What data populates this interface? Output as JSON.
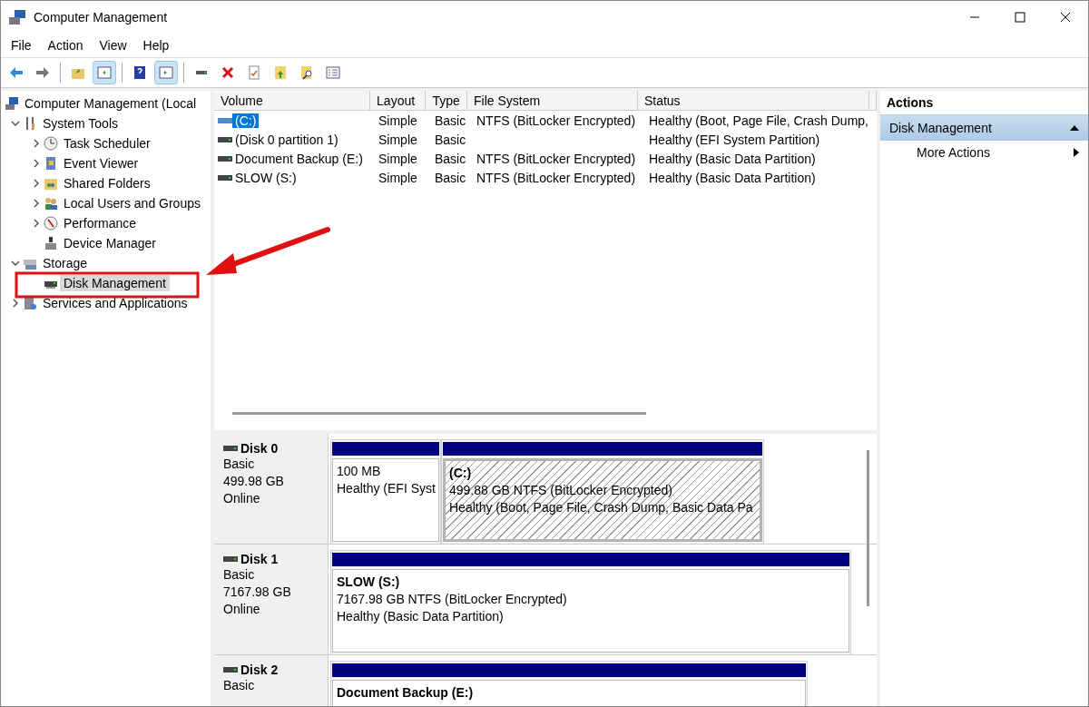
{
  "window": {
    "title": "Computer Management"
  },
  "menu": [
    {
      "label": "File"
    },
    {
      "label": "Action"
    },
    {
      "label": "View"
    },
    {
      "label": "Help"
    }
  ],
  "toolbar": [
    {
      "kind": "back",
      "pressed": false
    },
    {
      "kind": "forward",
      "pressed": false
    },
    {
      "kind": "sep"
    },
    {
      "kind": "up",
      "pressed": false
    },
    {
      "kind": "showtree",
      "pressed": true
    },
    {
      "kind": "sep"
    },
    {
      "kind": "help",
      "pressed": false
    },
    {
      "kind": "showaction",
      "pressed": true
    },
    {
      "kind": "sep"
    },
    {
      "kind": "connect",
      "pressed": false
    },
    {
      "kind": "delete",
      "pressed": false
    },
    {
      "kind": "check",
      "pressed": false
    },
    {
      "kind": "export",
      "pressed": false
    },
    {
      "kind": "find",
      "pressed": false
    },
    {
      "kind": "props",
      "pressed": false
    }
  ],
  "tree": [
    {
      "label": "Computer Management (Local",
      "selected": false,
      "children": [
        {
          "label": "System Tools",
          "expanded": true,
          "selected": false,
          "children": [
            {
              "label": "Task Scheduler",
              "expanded": false,
              "selected": false
            },
            {
              "label": "Event Viewer",
              "expanded": false,
              "selected": false
            },
            {
              "label": "Shared Folders",
              "expanded": false,
              "selected": false
            },
            {
              "label": "Local Users and Groups",
              "expanded": false,
              "selected": false
            },
            {
              "label": "Performance",
              "expanded": false,
              "selected": false
            },
            {
              "label": "Device Manager",
              "selected": false
            }
          ]
        },
        {
          "label": "Storage",
          "expanded": true,
          "selected": false,
          "children": [
            {
              "label": "Disk Management",
              "selected": true
            }
          ]
        },
        {
          "label": "Services and Applications",
          "expanded": false,
          "selected": false
        }
      ]
    }
  ],
  "table": {
    "columns": [
      "Volume",
      "Layout",
      "Type",
      "File System",
      "Status"
    ],
    "rows": [
      {
        "cells": [
          "(C:)",
          "Simple",
          "Basic",
          "NTFS (BitLocker Encrypted)",
          "Healthy (Boot, Page File, Crash Dump,"
        ],
        "selected": true
      },
      {
        "cells": [
          "(Disk 0 partition 1)",
          "Simple",
          "Basic",
          "",
          "Healthy (EFI System Partition)"
        ],
        "selected": false
      },
      {
        "cells": [
          "Document Backup (E:)",
          "Simple",
          "Basic",
          "NTFS (BitLocker Encrypted)",
          "Healthy (Basic Data Partition)"
        ],
        "selected": false
      },
      {
        "cells": [
          "SLOW (S:)",
          "Simple",
          "Basic",
          "NTFS (BitLocker Encrypted)",
          "Healthy (Basic Data Partition)"
        ],
        "selected": false
      }
    ]
  },
  "disks": [
    {
      "name": "Disk 0",
      "lines": [
        "Basic",
        "499.98 GB",
        "Online"
      ],
      "partitions": [
        {
          "lines": [
            "100 MB",
            "Healthy (EFI Syst"
          ],
          "selected": false
        },
        {
          "title": "(C:)",
          "lines": [
            "499.88 GB NTFS (BitLocker Encrypted)",
            "Healthy (Boot, Page File, Crash Dump, Basic Data Pa"
          ],
          "selected": true
        }
      ]
    },
    {
      "name": "Disk 1",
      "lines": [
        "Basic",
        "7167.98 GB",
        "Online"
      ],
      "partitions": [
        {
          "title": "SLOW  (S:)",
          "lines": [
            "7167.98 GB NTFS (BitLocker Encrypted)",
            "Healthy (Basic Data Partition)"
          ],
          "selected": false
        }
      ]
    },
    {
      "name": "Disk 2",
      "lines": [
        "Basic"
      ],
      "partitions": [
        {
          "title": "Document Backup  (E:)",
          "selected": false
        }
      ]
    }
  ],
  "actions": {
    "title": "Actions",
    "groups": [
      {
        "label": "Disk Management",
        "expanded": true,
        "items": [
          {
            "label": "More Actions"
          }
        ]
      }
    ]
  }
}
